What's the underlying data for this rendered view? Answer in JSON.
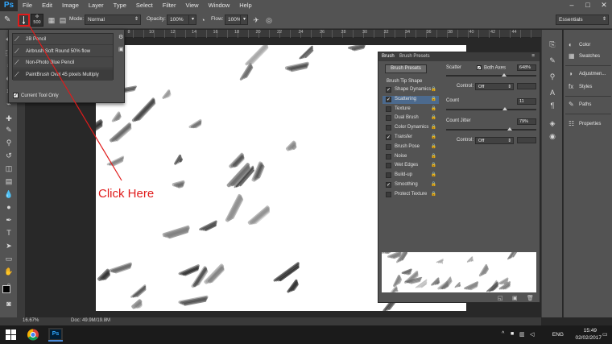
{
  "app": {
    "logo": "Ps"
  },
  "menu": [
    "File",
    "Edit",
    "Image",
    "Layer",
    "Type",
    "Select",
    "Filter",
    "View",
    "Window",
    "Help"
  ],
  "window_controls": [
    "–",
    "□",
    "✕"
  ],
  "options_bar": {
    "brush_size": "500",
    "mode_label": "Mode:",
    "mode_value": "Normal",
    "opacity_label": "Opacity:",
    "opacity_value": "100%",
    "flow_label": "Flow:",
    "flow_value": "100%",
    "workspace": "Essentials"
  },
  "ruler_numbers": [
    "2",
    "0",
    "2",
    "4",
    "6",
    "8",
    "10",
    "12",
    "14",
    "16",
    "18",
    "20",
    "22",
    "24",
    "26",
    "28",
    "30",
    "32",
    "34",
    "36",
    "38",
    "40",
    "42",
    "44"
  ],
  "brush_dropdown": {
    "items": [
      "2B Pencil",
      "Airbrush Soft Round 50% flow",
      "Non-Photo Blue Pencil",
      "PaintBrush Oval 45 pixels Multiply"
    ],
    "current_tool_only": "Current Tool Only"
  },
  "annotation": {
    "text": "Click Here",
    "color": "#e01b1b"
  },
  "brush_panel": {
    "tabs": [
      "Brush",
      "Brush Presets"
    ],
    "presets_button": "Brush Presets",
    "tip_shape": "Brush Tip Shape",
    "items": [
      {
        "label": "Shape Dynamics",
        "checked": true
      },
      {
        "label": "Scattering",
        "checked": true,
        "selected": true
      },
      {
        "label": "Texture",
        "checked": false
      },
      {
        "label": "Dual Brush",
        "checked": false
      },
      {
        "label": "Color Dynamics",
        "checked": false
      },
      {
        "label": "Transfer",
        "checked": true
      },
      {
        "label": "Brush Pose",
        "checked": false
      },
      {
        "label": "Noise",
        "checked": false
      },
      {
        "label": "Wet Edges",
        "checked": false
      },
      {
        "label": "Build-up",
        "checked": false
      },
      {
        "label": "Smoothing",
        "checked": true
      },
      {
        "label": "Protect Texture",
        "checked": false
      }
    ],
    "scatter_label": "Scatter",
    "both_axes_label": "Both Axes",
    "scatter_value": "648%",
    "control_label": "Control:",
    "control_value": "Off",
    "count_label": "Count",
    "count_value": "11",
    "count_jitter_label": "Count Jitter",
    "count_jitter_value": "79%",
    "control2_label": "Control:",
    "control2_value": "Off"
  },
  "right_panels": {
    "group1": [
      "Color",
      "Swatches"
    ],
    "group2": [
      "Adjustmen...",
      "Styles"
    ],
    "group3": [
      "Paths"
    ],
    "group4": [
      "Properties"
    ]
  },
  "status": {
    "zoom": "16.67%",
    "doc": "Doc: 49.9M/19.8M"
  },
  "taskbar": {
    "lang": "ENG",
    "time": "15:49",
    "date": "02/02/2017"
  }
}
